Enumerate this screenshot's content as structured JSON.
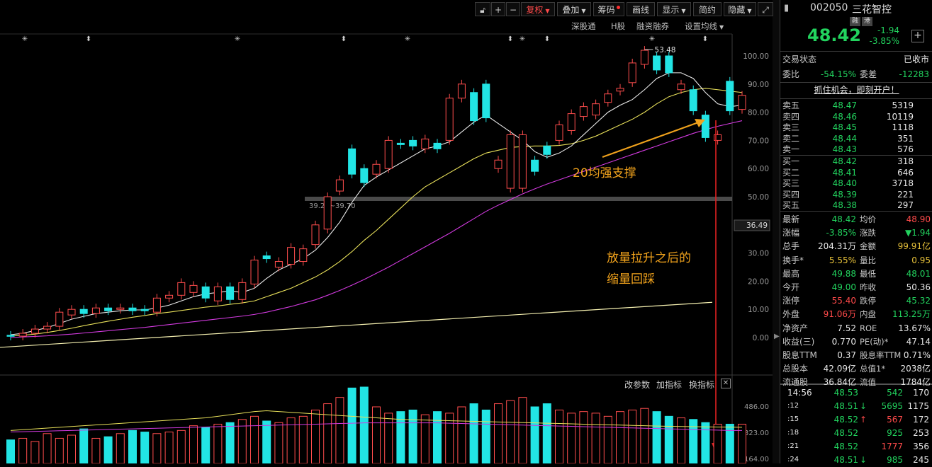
{
  "toolbar": {
    "icons": [
      "lock-icon",
      "plus-icon",
      "minus-icon"
    ],
    "adjust": "复权",
    "overlay": "叠加",
    "chips": "筹码",
    "draw": "画线",
    "display": "显示",
    "brief": "简约",
    "hide": "隐藏",
    "sublinks": [
      "深股通",
      "H股",
      "融资融券",
      "设置均线"
    ]
  },
  "stock": {
    "code": "002050",
    "name": "三花智控",
    "tag1": "融",
    "tag2": "港",
    "price": "48.42",
    "change": "-1.94",
    "change_pct": "-3.85%",
    "status_label": "交易状态",
    "status_value": "已收市",
    "ratio_label": "委比",
    "ratio_value": "-54.15%",
    "diff_label": "委差",
    "diff_value": "-12283",
    "promo": "抓住机会，即刻开户！"
  },
  "order_book": {
    "sells": [
      {
        "label": "卖五",
        "price": "48.47",
        "vol": "5319"
      },
      {
        "label": "卖四",
        "price": "48.46",
        "vol": "10119"
      },
      {
        "label": "卖三",
        "price": "48.45",
        "vol": "1118"
      },
      {
        "label": "卖二",
        "price": "48.44",
        "vol": "351"
      },
      {
        "label": "卖一",
        "price": "48.43",
        "vol": "576"
      }
    ],
    "buys": [
      {
        "label": "买一",
        "price": "48.42",
        "vol": "318"
      },
      {
        "label": "买二",
        "price": "48.41",
        "vol": "646"
      },
      {
        "label": "买三",
        "price": "48.40",
        "vol": "3718"
      },
      {
        "label": "买四",
        "price": "48.39",
        "vol": "221"
      },
      {
        "label": "买五",
        "price": "48.38",
        "vol": "297"
      }
    ]
  },
  "quote": [
    {
      "l1": "最新",
      "v1": "48.42",
      "c1": "grn",
      "l2": "均价",
      "v2": "48.90",
      "c2": "red"
    },
    {
      "l1": "涨幅",
      "v1": "-3.85%",
      "c1": "grn",
      "l2": "涨跌",
      "v2": "▼1.94",
      "c2": "grn"
    },
    {
      "l1": "总手",
      "v1": "204.31万",
      "c1": "wht",
      "l2": "金额",
      "v2": "99.91亿",
      "c2": "yel"
    },
    {
      "l1": "换手*",
      "v1": "5.55%",
      "c1": "yel",
      "l2": "量比",
      "v2": "0.95",
      "c2": "yel"
    },
    {
      "l1": "最高",
      "v1": "49.88",
      "c1": "grn",
      "l2": "最低",
      "v2": "48.01",
      "c2": "grn"
    },
    {
      "l1": "今开",
      "v1": "49.00",
      "c1": "grn",
      "l2": "昨收",
      "v2": "50.36",
      "c2": "wht"
    },
    {
      "l1": "涨停",
      "v1": "55.40",
      "c1": "red",
      "l2": "跌停",
      "v2": "45.32",
      "c2": "grn"
    },
    {
      "l1": "外盘",
      "v1": "91.06万",
      "c1": "red",
      "l2": "内盘",
      "v2": "113.25万",
      "c2": "grn"
    },
    {
      "l1": "净资产",
      "v1": "7.52",
      "c1": "wht",
      "l2": "ROE",
      "v2": "13.67%",
      "c2": "wht"
    },
    {
      "l1": "收益(三)",
      "v1": "0.770",
      "c1": "wht",
      "l2": "PE(动)*",
      "v2": "47.14",
      "c2": "wht"
    },
    {
      "l1": "股息TTM",
      "v1": "0.37",
      "c1": "wht",
      "l2": "股息率TTM",
      "v2": "0.71%",
      "c2": "wht"
    },
    {
      "l1": "总股本",
      "v1": "42.09亿",
      "c1": "wht",
      "l2": "总值1*",
      "v2": "2038亿",
      "c2": "wht"
    },
    {
      "l1": "流通股",
      "v1": "36.84亿",
      "c1": "wht",
      "l2": "流值",
      "v2": "1784亿",
      "c2": "wht"
    }
  ],
  "ticks": [
    {
      "time": "14:56",
      "price": "48.53",
      "arrow": "",
      "vol": "542",
      "num": "170",
      "vc": "grn"
    },
    {
      "time": ":12",
      "price": "48.51",
      "arrow": "↓",
      "vol": "5695",
      "num": "1175",
      "vc": "grn"
    },
    {
      "time": ":15",
      "price": "48.52",
      "arrow": "↑",
      "vol": "567",
      "num": "172",
      "vc": "red"
    },
    {
      "time": ":18",
      "price": "48.52",
      "arrow": "",
      "vol": "925",
      "num": "253",
      "vc": "grn"
    },
    {
      "time": ":21",
      "price": "48.52",
      "arrow": "",
      "vol": "1777",
      "num": "356",
      "vc": "red"
    },
    {
      "time": ":24",
      "price": "48.51",
      "arrow": "↓",
      "vol": "985",
      "num": "245",
      "vc": "grn"
    }
  ],
  "chart_data": {
    "type": "candlestick",
    "y_ticks": [
      "100.00",
      "90.00",
      "80.00",
      "70.00",
      "60.00",
      "50.00",
      "40.00",
      "30.00",
      "20.00",
      "10.00",
      "0.00"
    ],
    "current_price_label": "36.49",
    "peak_label": "53.48",
    "range_label": "39.23~39.70",
    "candles": [
      {
        "o": 0.8,
        "c": 0.5
      },
      {
        "o": 0.5,
        "c": 1.5
      },
      {
        "o": 1.5,
        "c": 3.0
      },
      {
        "o": 3.0,
        "c": 4.0
      },
      {
        "o": 4.0,
        "c": 9.0
      },
      {
        "o": 8.0,
        "c": 10.0
      },
      {
        "o": 10.0,
        "c": 8.5
      },
      {
        "o": 8.5,
        "c": 10.5
      },
      {
        "o": 10.5,
        "c": 9.5
      },
      {
        "o": 10.0,
        "c": 10.5
      },
      {
        "o": 10.5,
        "c": 9.5
      },
      {
        "o": 10.0,
        "c": 9.5
      },
      {
        "o": 9.0,
        "c": 14.0
      },
      {
        "o": 14.0,
        "c": 15.0
      },
      {
        "o": 15.0,
        "c": 19.5
      },
      {
        "o": 16.0,
        "c": 18.5
      },
      {
        "o": 18.0,
        "c": 14.0
      },
      {
        "o": 13.0,
        "c": 18.0
      },
      {
        "o": 18.0,
        "c": 13.5
      },
      {
        "o": 13.5,
        "c": 19.5
      },
      {
        "o": 19.0,
        "c": 27.5
      },
      {
        "o": 29.0,
        "c": 28.0
      },
      {
        "o": 25.0,
        "c": 27.0
      },
      {
        "o": 26.0,
        "c": 32.0
      },
      {
        "o": 27.0,
        "c": 31.5
      },
      {
        "o": 33.0,
        "c": 40.0
      },
      {
        "o": 38.5,
        "c": 50.0
      },
      {
        "o": 52.0,
        "c": 56.0
      },
      {
        "o": 67.0,
        "c": 58.0
      },
      {
        "o": 60.0,
        "c": 55.0
      },
      {
        "o": 58.0,
        "c": 61.5
      },
      {
        "o": 60.0,
        "c": 70.0
      },
      {
        "o": 69.0,
        "c": 68.5
      },
      {
        "o": 70.0,
        "c": 68.0
      },
      {
        "o": 67.0,
        "c": 70.5
      },
      {
        "o": 69.0,
        "c": 67.0
      },
      {
        "o": 70.0,
        "c": 85.0
      },
      {
        "o": 85.0,
        "c": 90.0
      },
      {
        "o": 87.0,
        "c": 77.0
      },
      {
        "o": 90.0,
        "c": 78.0
      },
      {
        "o": 60.0,
        "c": 63.0
      },
      {
        "o": 53.0,
        "c": 72.0
      },
      {
        "o": 53.0,
        "c": 72.0
      },
      {
        "o": 63.0,
        "c": 59.0
      },
      {
        "o": 68.0,
        "c": 65.0
      },
      {
        "o": 70.0,
        "c": 75.5
      },
      {
        "o": 73.5,
        "c": 79.5
      },
      {
        "o": 78.5,
        "c": 82.0
      },
      {
        "o": 79.0,
        "c": 83.0
      },
      {
        "o": 83.5,
        "c": 86.5
      },
      {
        "o": 87.5,
        "c": 88.5
      },
      {
        "o": 90.5,
        "c": 97.5
      },
      {
        "o": 97.0,
        "c": 102.0
      },
      {
        "o": 100.0,
        "c": 95.0
      },
      {
        "o": 100.0,
        "c": 94.0
      },
      {
        "o": 88.0,
        "c": 90.0
      },
      {
        "o": 88.0,
        "c": 80.5
      },
      {
        "o": 79.0,
        "c": 71.0
      },
      {
        "o": 70.0,
        "c": 72.0
      },
      {
        "o": 91.0,
        "c": 80.5
      },
      {
        "o": 81.0,
        "c": 86.0
      }
    ],
    "ma5": [
      1.0,
      1.5,
      2.5,
      3.5,
      5.0,
      6.5,
      7.5,
      8.5,
      9.0,
      9.5,
      9.8,
      9.8,
      10.5,
      11.5,
      13.0,
      14.5,
      15.5,
      16.0,
      16.5,
      16.0,
      17.5,
      21.0,
      24.0,
      26.0,
      28.0,
      31.0,
      35.5,
      41.0,
      48.0,
      54.0,
      57.0,
      59.5,
      62.0,
      64.5,
      67.0,
      68.0,
      69.5,
      73.0,
      76.5,
      79.0,
      76.0,
      73.0,
      70.0,
      66.0,
      64.0,
      65.5,
      68.0,
      72.0,
      76.0,
      80.0,
      82.5,
      84.5,
      88.0,
      92.0,
      94.0,
      94.0,
      92.0,
      87.0,
      83.0,
      82.0,
      82.5
    ],
    "ma10": [
      0.5,
      0.8,
      1.2,
      1.8,
      2.5,
      3.3,
      4.2,
      5.0,
      5.8,
      6.5,
      7.2,
      7.8,
      8.5,
      9.0,
      9.6,
      10.2,
      10.8,
      11.2,
      11.8,
      12.3,
      13.0,
      14.5,
      16.0,
      17.5,
      19.5,
      21.5,
      24.0,
      27.0,
      30.5,
      34.5,
      38.0,
      42.0,
      46.0,
      50.0,
      53.5,
      56.0,
      58.5,
      61.0,
      63.5,
      65.5,
      66.5,
      67.5,
      67.8,
      68.0,
      68.0,
      68.2,
      68.8,
      70.0,
      71.5,
      73.5,
      75.5,
      77.5,
      80.0,
      83.0,
      85.5,
      87.0,
      88.0,
      88.5,
      88.0,
      87.5,
      87.0
    ],
    "ma20": [
      0.0,
      0.2,
      0.4,
      0.6,
      0.9,
      1.2,
      1.6,
      2.0,
      2.4,
      2.8,
      3.2,
      3.6,
      4.1,
      4.6,
      5.1,
      5.6,
      6.1,
      6.6,
      7.1,
      7.6,
      8.2,
      9.0,
      10.0,
      11.0,
      12.2,
      13.4,
      15.0,
      16.7,
      18.6,
      20.6,
      22.8,
      25.0,
      27.4,
      29.8,
      32.2,
      34.6,
      37.0,
      39.6,
      42.2,
      44.8,
      47.0,
      49.0,
      51.0,
      52.8,
      54.5,
      56.0,
      57.5,
      59.0,
      60.5,
      62.0,
      63.5,
      65.0,
      66.5,
      68.0,
      69.5,
      71.0,
      72.5,
      73.8,
      75.0,
      76.0,
      77.0
    ],
    "ma_long_start": -3.5,
    "ma_long_end": 12.5,
    "volume_ticks": [
      "486.00",
      "323.00",
      "164.00",
      "0.00"
    ],
    "volumes": [
      150,
      160,
      140,
      190,
      160,
      180,
      220,
      160,
      170,
      190,
      210,
      200,
      190,
      200,
      210,
      240,
      230,
      250,
      260,
      280,
      300,
      270,
      260,
      290,
      300,
      340,
      380,
      420,
      480,
      520,
      360,
      320,
      330,
      340,
      310,
      330,
      320,
      360,
      380,
      340,
      380,
      400,
      420,
      360,
      380,
      340,
      320,
      330,
      320,
      300,
      330,
      340,
      350,
      330,
      300,
      290,
      280,
      260,
      250,
      250,
      250
    ],
    "volume_ma": [
      210,
      215,
      220,
      225,
      230,
      235,
      240,
      245,
      250,
      255,
      260,
      265,
      270,
      275,
      280,
      285,
      290,
      300,
      310,
      320,
      330,
      335,
      330,
      325,
      320,
      315,
      310,
      305,
      300,
      295,
      290,
      285,
      280,
      278,
      276,
      274,
      272,
      270,
      268,
      266,
      264,
      262,
      260,
      258,
      256,
      254,
      252,
      250,
      248,
      246,
      244,
      242,
      240,
      238,
      236,
      235,
      234,
      233,
      232,
      231,
      230
    ],
    "volume_ma2": [
      200,
      202,
      204,
      206,
      208,
      210,
      212,
      214,
      216,
      218,
      220,
      222,
      224,
      226,
      228,
      230,
      232,
      234,
      236,
      238,
      240,
      242,
      244,
      246,
      248,
      250,
      252,
      254,
      256,
      258,
      258,
      258,
      258,
      258,
      258,
      258,
      256,
      254,
      252,
      250,
      248,
      246,
      244,
      242,
      240,
      238,
      236,
      234,
      232,
      230,
      228,
      226,
      224,
      222,
      220,
      218,
      216,
      214,
      212,
      210,
      210
    ],
    "indicator_buttons": [
      "改参数",
      "加指标",
      "换指标"
    ],
    "annotations": [
      "20均强支撑",
      "放量拉升之后的",
      "缩量回踩"
    ]
  }
}
